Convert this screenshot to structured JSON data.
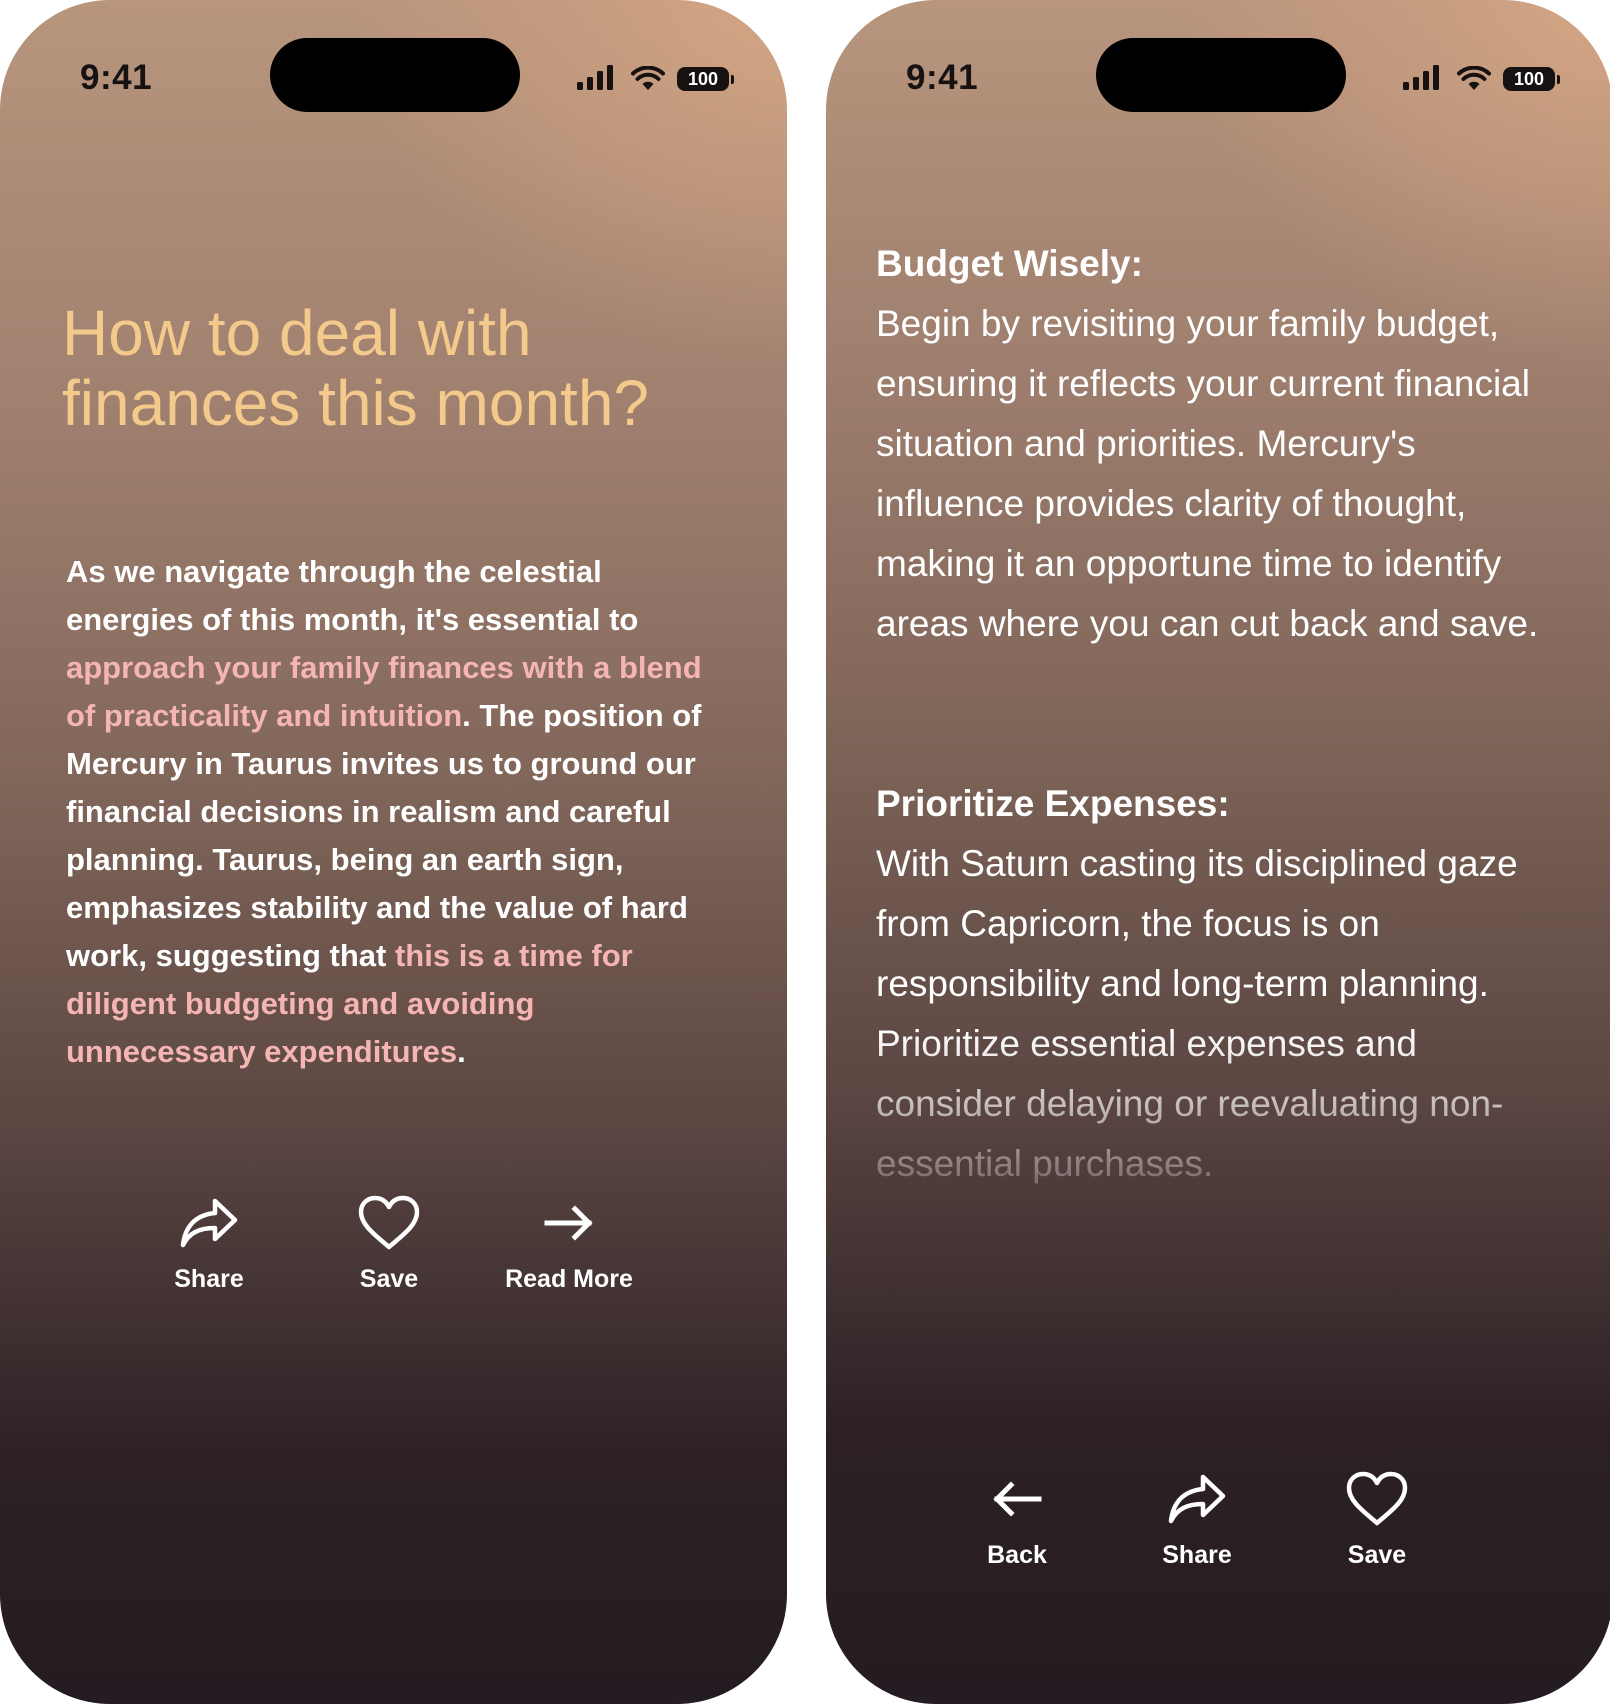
{
  "status_bar": {
    "time": "9:41",
    "battery": "100"
  },
  "screen1": {
    "title": "How to deal with finances this month?",
    "body": {
      "p1": "As we navigate through the celestial energies of this month, it's essential to ",
      "h1": "approach your family finances with a blend of practicality and intuition",
      "p2": ". The position of Mercury in Taurus invites us to ground our financial decisions in realism and careful planning. Taurus, being an earth sign, emphasizes stability and the value of hard work, suggesting that ",
      "h2": "this is a time for diligent budgeting and avoiding unnecessary expenditures",
      "p3": "."
    },
    "actions": [
      {
        "label": "Share",
        "icon": "share-icon"
      },
      {
        "label": "Save",
        "icon": "heart-icon"
      },
      {
        "label": "Read More",
        "icon": "arrow-right-icon"
      }
    ]
  },
  "screen2": {
    "sections": [
      {
        "heading": "Budget Wisely:",
        "body": "Begin by revisiting your family budget, ensuring it reflects your current financial situation and priorities. Mercury's influence provides clarity of thought, making it an opportune time to identify areas where you can cut back and save."
      },
      {
        "heading": "Prioritize Expenses:",
        "body": "With Saturn casting its disciplined gaze from Capricorn, the focus is on responsibility and long-term planning. Prioritize essential expenses and consider delaying or reevaluating non-essential purchases."
      }
    ],
    "actions": [
      {
        "label": "Back",
        "icon": "arrow-left-icon"
      },
      {
        "label": "Share",
        "icon": "share-icon"
      },
      {
        "label": "Save",
        "icon": "heart-icon"
      }
    ]
  },
  "colors": {
    "title": "#f3c98c",
    "highlight": "#f5b5b2",
    "text": "#ffffff"
  }
}
